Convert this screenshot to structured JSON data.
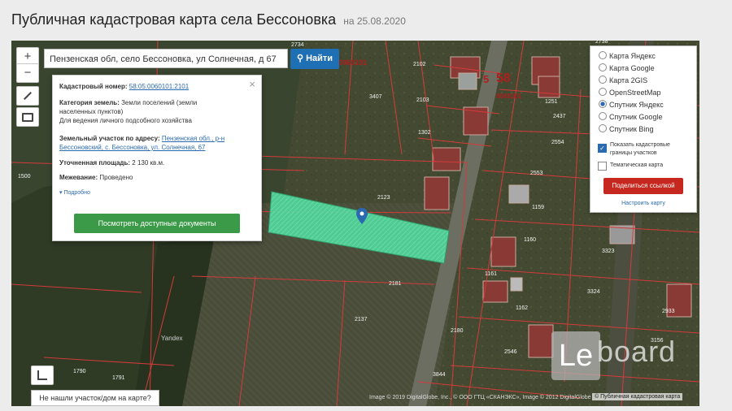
{
  "page": {
    "title": "Публичная кадастровая карта села Бессоновка",
    "date": "на 25.08.2020"
  },
  "search": {
    "value": "Пензенская обл, село Бессоновка, ул Солнечная, д 67",
    "button_label": "Найти",
    "button_icon": "search-icon"
  },
  "controls": {
    "zoom_in": "+",
    "zoom_out": "−"
  },
  "info_card": {
    "cadastral_label": "Кадастровый номер:",
    "cadastral_value": "58:05:0060101:2101",
    "category_label": "Категория земель:",
    "category_value_1": "Земли поселений (земли",
    "category_value_2": "населенных пунктов)",
    "category_value_3": "Для ведения личного подсобного хозяйства",
    "address_label": "Земельный участок по адресу:",
    "address_value_1": "Пензенская обл., р-н",
    "address_value_2": "Бессоновский, с. Бессоновка, ул. Солнечная, 67",
    "area_label": "Уточненная площадь:",
    "area_value": "2 130 кв.м.",
    "survey_label": "Межевание:",
    "survey_value": "Проведено",
    "more_label": "▾ Подробно",
    "docs_button": "Посмотреть доступные документы",
    "close": "×"
  },
  "layers": {
    "options": [
      {
        "label": "Карта Яндекс",
        "selected": false
      },
      {
        "label": "Карта Google",
        "selected": false
      },
      {
        "label": "Карта 2GIS",
        "selected": false
      },
      {
        "label": "OpenStreetMap",
        "selected": false
      },
      {
        "label": "Спутник Яндекс",
        "selected": true
      },
      {
        "label": "Спутник Google",
        "selected": false
      },
      {
        "label": "Спутник Bing",
        "selected": false
      }
    ],
    "show_borders_1": "Показать кадастровые",
    "show_borders_2": "границы участков",
    "show_borders_checked": true,
    "thematic_label": "Тематическая карта",
    "thematic_checked": false,
    "share_button": "Поделиться ссылкой",
    "setup_link": "Настроить карту"
  },
  "map": {
    "quarter_label": "58",
    "quarter_digit": "5",
    "quarter_code_1": "0060101",
    "quarter_code_2": "0060101",
    "parcels": [
      "2102",
      "2103",
      "3407",
      "1302",
      "2437",
      "2554",
      "2553",
      "1251",
      "1159",
      "1160",
      "1161",
      "1162",
      "2123",
      "2181",
      "2137",
      "2180",
      "2546",
      "3156",
      "3324",
      "3323",
      "2933",
      "1790",
      "1791",
      "3844",
      "1500",
      "2738",
      "2734"
    ],
    "yandex_mark": "Yandex",
    "not_found_button": "Не нашли участок/дом на карте?",
    "attribution": "Image © 2019 DigitalGlobe, Inc., © ООО ГТЦ «СКАНЭКС», Image © 2012 DigitalGlobe",
    "rosreestr": "© Публичная кадастровая карта"
  },
  "watermark": {
    "box": "Le",
    "text": "board"
  },
  "colors": {
    "selected_parcel": "#4fd79b",
    "boundary": "#d43b3b",
    "search_button": "#1f6fb4",
    "docs_button": "#3b9a47",
    "share_button": "#c6281f"
  }
}
